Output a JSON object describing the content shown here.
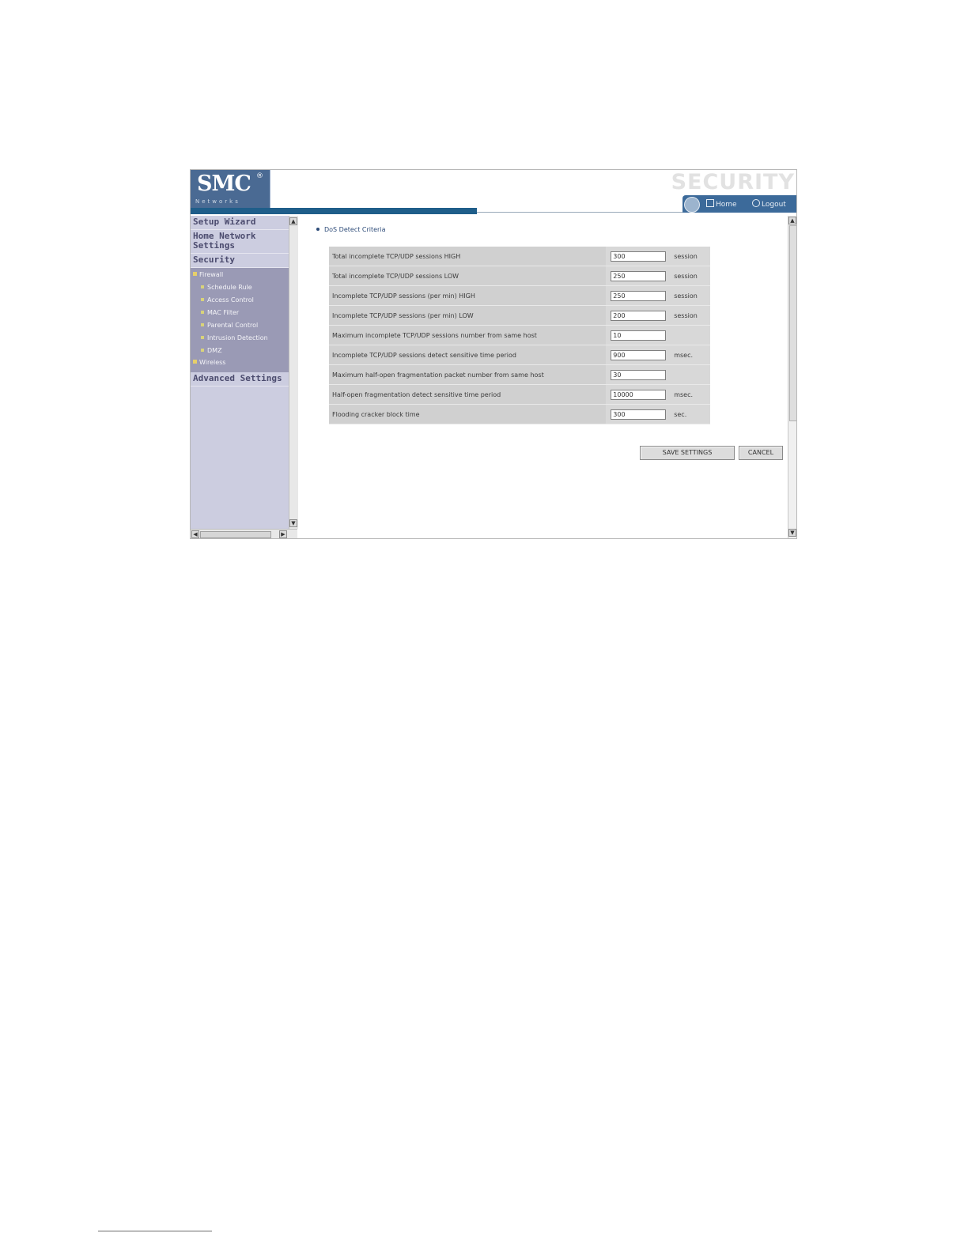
{
  "header": {
    "logo_brand": "SMC",
    "logo_reg": "®",
    "logo_sub": "Networks",
    "section_title": "SECURITY",
    "nav_home": "Home",
    "nav_logout": "Logout"
  },
  "sidebar": {
    "items": [
      {
        "label": "Setup Wizard"
      },
      {
        "label": "Home Network Settings"
      },
      {
        "label": "Security"
      },
      {
        "label": "Advanced Settings"
      }
    ],
    "security_sub": {
      "firewall": "Firewall",
      "firewall_items": [
        "Schedule Rule",
        "Access Control",
        "MAC Filter",
        "Parental Control",
        "Intrusion Detection",
        "DMZ"
      ],
      "wireless": "Wireless"
    }
  },
  "main": {
    "section_title": "DoS Detect Criteria",
    "rows": [
      {
        "label": "Total incomplete TCP/UDP sessions HIGH",
        "value": "300",
        "unit": "session"
      },
      {
        "label": "Total incomplete TCP/UDP sessions LOW",
        "value": "250",
        "unit": "session"
      },
      {
        "label": "Incomplete TCP/UDP sessions (per min) HIGH",
        "value": "250",
        "unit": "session"
      },
      {
        "label": "Incomplete TCP/UDP sessions (per min) LOW",
        "value": "200",
        "unit": "session"
      },
      {
        "label": "Maximum incomplete TCP/UDP sessions number from same host",
        "value": "10",
        "unit": ""
      },
      {
        "label": "Incomplete TCP/UDP sessions detect sensitive time period",
        "value": "900",
        "unit": "msec."
      },
      {
        "label": "Maximum half-open fragmentation packet number from same host",
        "value": "30",
        "unit": ""
      },
      {
        "label": "Half-open fragmentation detect sensitive time period",
        "value": "10000",
        "unit": "msec."
      },
      {
        "label": "Flooding cracker block time",
        "value": "300",
        "unit": "sec."
      }
    ],
    "save_label": "SAVE SETTINGS",
    "cancel_label": "CANCEL"
  },
  "colors": {
    "logo_bg": "#4a6a93",
    "header_bar": "#1f5e8a",
    "sidebar_bg": "#cccde0",
    "sidebar_sub_bg": "#9a9ab5",
    "table_bg": "#d3d3d3"
  },
  "icons": {
    "globe": "globe-icon",
    "home": "home-icon",
    "logout": "logout-icon"
  }
}
